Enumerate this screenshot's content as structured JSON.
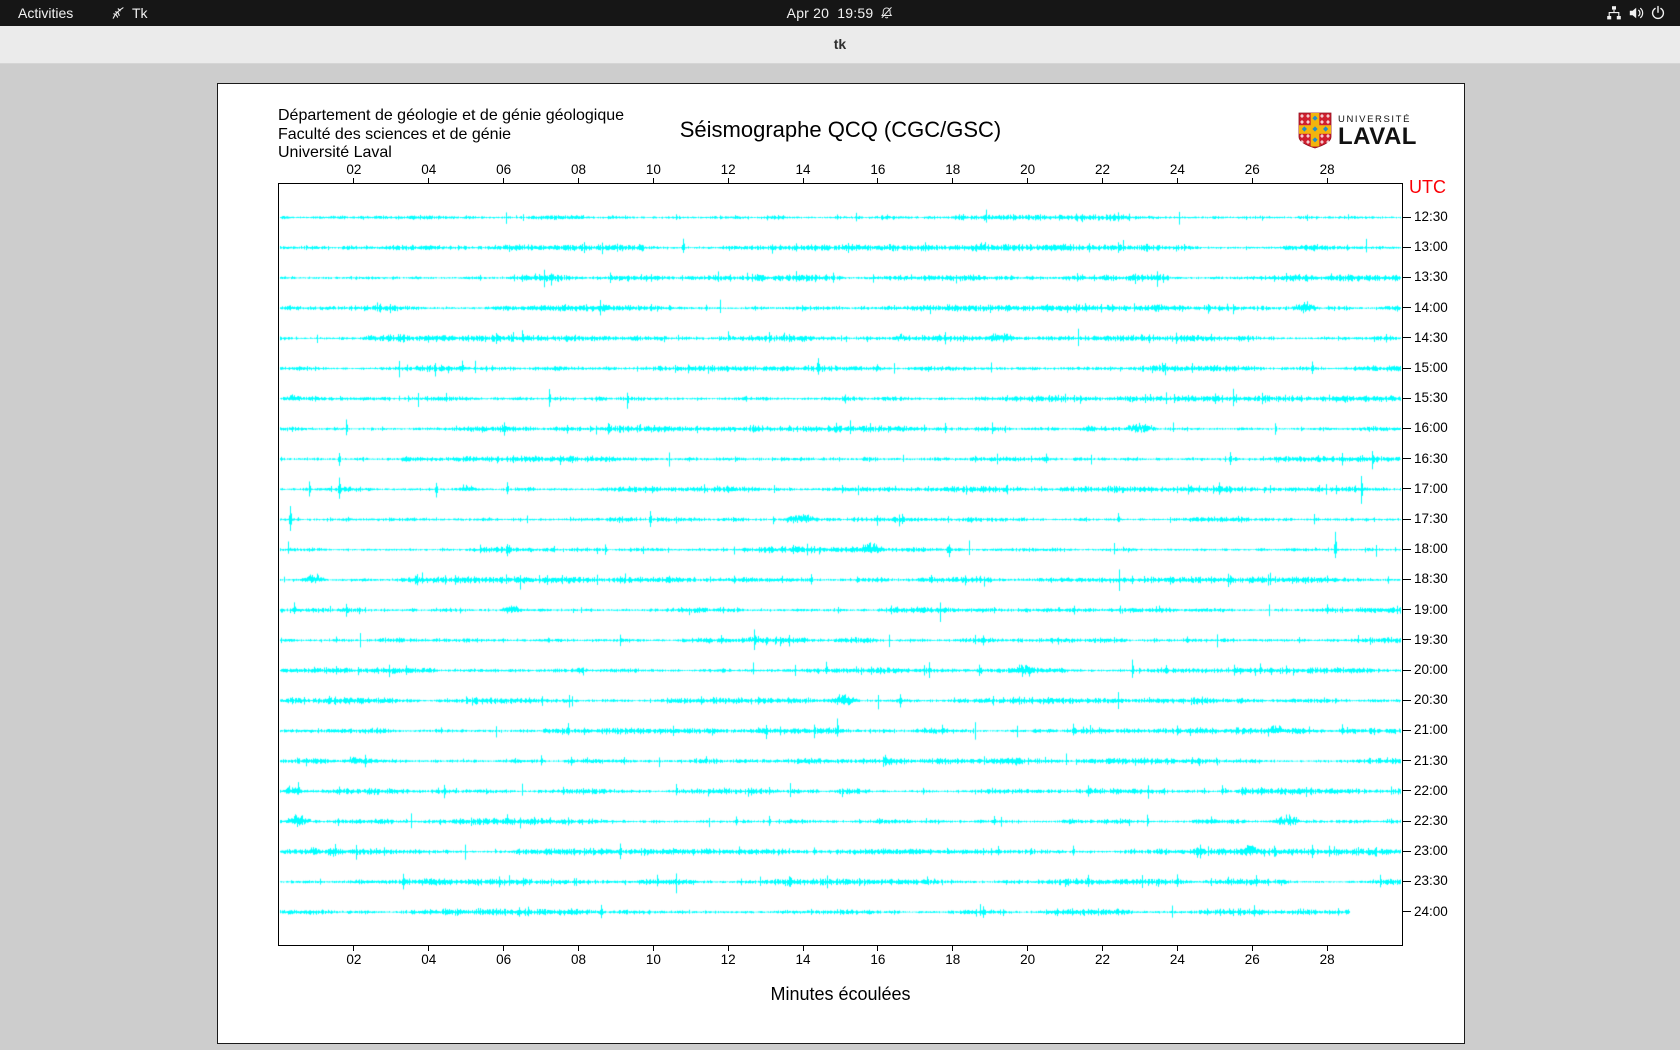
{
  "topbar": {
    "activities": "Activities",
    "app_name": "Tk",
    "clock_date": "Apr 20",
    "clock_time": "19:59"
  },
  "titlebar": {
    "title": "tk"
  },
  "window": {
    "header_lines": [
      "Département de géologie et de génie géologique",
      "Faculté des sciences et de génie",
      "Université Laval"
    ],
    "logo": {
      "small": "UNIVERSITÉ",
      "big": "LAVAL"
    }
  },
  "colors": {
    "trace": "#00ffff",
    "utc_label": "#fb0006",
    "frame": "#000000",
    "window_bg": "#ffffff",
    "desktop_bg": "#cdcdcd",
    "topbar_bg": "#161616",
    "titlebar_bg": "#ebebeb"
  },
  "chart_data": {
    "type": "line",
    "subtype": "seismogram-helicorder",
    "station": "QCQ (CGC/GSC)",
    "title": "Séismographe QCQ (CGC/GSC)",
    "xlabel": "Minutes écoulées",
    "right_axis_title": "UTC",
    "x_range_minutes": [
      0,
      30
    ],
    "x_ticks": [
      "02",
      "04",
      "06",
      "08",
      "10",
      "12",
      "14",
      "16",
      "18",
      "20",
      "22",
      "24",
      "26",
      "28"
    ],
    "trace_interval_minutes": 30,
    "trace_color": "#00ffff",
    "grid": false,
    "traces": [
      {
        "utc": "12:30",
        "seed": 101,
        "spikes": [
          [
            14.9,
            5
          ]
        ],
        "bursts": []
      },
      {
        "utc": "13:00",
        "seed": 102,
        "spikes": [
          [
            10.8,
            10
          ],
          [
            23.2,
            4
          ]
        ],
        "bursts": []
      },
      {
        "utc": "13:30",
        "seed": 103,
        "spikes": [
          [
            14.8,
            9
          ],
          [
            28.1,
            5
          ]
        ],
        "bursts": []
      },
      {
        "utc": "14:00",
        "seed": 104,
        "spikes": [
          [
            2.7,
            8
          ],
          [
            11.4,
            4
          ]
        ],
        "bursts": [
          [
            27.4,
            0.8,
            2.5
          ]
        ]
      },
      {
        "utc": "14:30",
        "seed": 105,
        "spikes": [
          [
            6.5,
            8
          ],
          [
            12.0,
            7
          ]
        ],
        "bursts": [
          [
            19.3,
            1.0,
            2.5
          ],
          [
            16.6,
            0.5,
            2.0
          ]
        ]
      },
      {
        "utc": "15:00",
        "seed": 106,
        "spikes": [
          [
            4.9,
            9
          ],
          [
            5.7,
            6
          ],
          [
            14.4,
            10
          ],
          [
            23.6,
            7
          ],
          [
            27.6,
            8
          ]
        ],
        "bursts": []
      },
      {
        "utc": "15:30",
        "seed": 107,
        "spikes": [
          [
            7.2,
            10
          ],
          [
            9.3,
            12
          ],
          [
            25.0,
            9
          ]
        ],
        "bursts": [
          [
            0.4,
            0.5,
            2.0
          ]
        ]
      },
      {
        "utc": "16:00",
        "seed": 108,
        "spikes": [
          [
            1.8,
            9
          ],
          [
            6.0,
            8
          ],
          [
            7.7,
            7
          ],
          [
            12.9,
            6
          ],
          [
            17.8,
            7
          ],
          [
            26.6,
            8
          ]
        ],
        "bursts": [
          [
            23.0,
            1.0,
            2.5
          ]
        ]
      },
      {
        "utc": "16:30",
        "seed": 109,
        "spikes": [
          [
            1.6,
            8
          ],
          [
            7.5,
            7
          ],
          [
            20.5,
            6
          ],
          [
            25.4,
            7
          ],
          [
            29.2,
            16
          ]
        ],
        "bursts": []
      },
      {
        "utc": "17:00",
        "seed": 110,
        "spikes": [
          [
            0.8,
            10
          ],
          [
            1.6,
            12
          ],
          [
            4.2,
            10
          ],
          [
            6.1,
            8
          ],
          [
            28.9,
            18
          ]
        ],
        "bursts": [
          [
            5.0,
            0.5,
            2.0
          ]
        ]
      },
      {
        "utc": "17:30",
        "seed": 111,
        "spikes": [
          [
            0.3,
            14
          ],
          [
            9.9,
            12
          ],
          [
            13.2,
            6
          ],
          [
            22.4,
            7
          ]
        ],
        "bursts": [
          [
            13.9,
            1.0,
            2.5
          ]
        ]
      },
      {
        "utc": "18:00",
        "seed": 112,
        "spikes": [
          [
            6.1,
            8
          ],
          [
            8.7,
            7
          ],
          [
            17.9,
            9
          ],
          [
            28.2,
            20
          ]
        ],
        "bursts": [
          [
            15.8,
            0.8,
            2.8
          ]
        ]
      },
      {
        "utc": "18:30",
        "seed": 113,
        "spikes": [
          [
            14.2,
            10
          ],
          [
            22.8,
            8
          ],
          [
            28.0,
            5
          ]
        ],
        "bursts": [
          [
            0.9,
            0.8,
            2.5
          ]
        ]
      },
      {
        "utc": "19:00",
        "seed": 114,
        "spikes": [
          [
            0.4,
            8
          ],
          [
            1.8,
            9
          ],
          [
            16.5,
            6
          ],
          [
            23.5,
            5
          ],
          [
            28.0,
            6
          ]
        ],
        "bursts": [
          [
            6.2,
            0.6,
            2.2
          ]
        ]
      },
      {
        "utc": "19:30",
        "seed": 115,
        "spikes": [
          [
            11.8,
            6
          ],
          [
            12.7,
            12
          ],
          [
            18.8,
            9
          ]
        ],
        "bursts": [
          [
            12.7,
            0.5,
            2.0
          ]
        ]
      },
      {
        "utc": "20:00",
        "seed": 116,
        "spikes": [
          [
            3.4,
            10
          ],
          [
            14.6,
            9
          ],
          [
            18.7,
            7
          ],
          [
            22.8,
            11
          ],
          [
            23.7,
            9
          ],
          [
            25.5,
            8
          ],
          [
            26.2,
            7
          ]
        ],
        "bursts": [
          [
            19.9,
            0.7,
            2.6
          ]
        ]
      },
      {
        "utc": "20:30",
        "seed": 117,
        "spikes": [
          [
            5.0,
            7
          ],
          [
            12.8,
            5
          ],
          [
            16.6,
            9
          ],
          [
            19.6,
            6
          ]
        ],
        "bursts": [
          [
            15.1,
            0.9,
            2.8
          ]
        ]
      },
      {
        "utc": "21:00",
        "seed": 118,
        "spikes": [
          [
            13.0,
            10
          ],
          [
            14.9,
            12
          ],
          [
            17.7,
            8
          ],
          [
            21.2,
            7
          ],
          [
            28.4,
            9
          ]
        ],
        "bursts": [
          [
            26.6,
            0.6,
            2.4
          ]
        ]
      },
      {
        "utc": "21:30",
        "seed": 119,
        "spikes": [
          [
            2.3,
            8
          ],
          [
            7.0,
            9
          ],
          [
            7.8,
            7
          ],
          [
            11.4,
            6
          ],
          [
            16.2,
            7
          ],
          [
            24.4,
            6
          ]
        ],
        "bursts": [
          [
            2.0,
            0.5,
            2.0
          ]
        ]
      },
      {
        "utc": "22:00",
        "seed": 120,
        "spikes": [
          [
            0.5,
            9
          ],
          [
            1.6,
            8
          ],
          [
            4.4,
            10
          ],
          [
            7.6,
            8
          ],
          [
            10.6,
            7
          ],
          [
            13.1,
            6
          ],
          [
            17.2,
            6
          ],
          [
            21.6,
            7
          ],
          [
            25.2,
            6
          ]
        ],
        "bursts": [
          [
            0.3,
            0.6,
            2.2
          ]
        ]
      },
      {
        "utc": "22:30",
        "seed": 121,
        "spikes": [
          [
            6.1,
            8
          ],
          [
            12.2,
            7
          ],
          [
            13.1,
            6
          ],
          [
            19.1,
            7
          ],
          [
            23.2,
            9
          ],
          [
            24.9,
            6
          ]
        ],
        "bursts": [
          [
            0.5,
            0.8,
            3.0
          ],
          [
            26.9,
            0.9,
            2.6
          ]
        ]
      },
      {
        "utc": "23:00",
        "seed": 122,
        "spikes": [
          [
            1.5,
            8
          ],
          [
            2.6,
            7
          ],
          [
            9.1,
            9
          ],
          [
            12.3,
            7
          ],
          [
            14.3,
            8
          ],
          [
            19.2,
            7
          ],
          [
            21.2,
            6
          ],
          [
            24.6,
            8
          ],
          [
            27.6,
            10
          ]
        ],
        "bursts": [
          [
            25.9,
            0.8,
            2.8
          ],
          [
            0.9,
            0.5,
            2.2
          ]
        ]
      },
      {
        "utc": "23:30",
        "seed": 123,
        "spikes": [
          [
            3.3,
            10
          ],
          [
            10.1,
            7
          ],
          [
            17.3,
            6
          ],
          [
            21.6,
            8
          ],
          [
            24.0,
            9
          ],
          [
            26.1,
            7
          ]
        ],
        "bursts": []
      },
      {
        "utc": "24:00",
        "seed": 124,
        "spikes": [
          [
            6.4,
            9
          ],
          [
            8.6,
            8
          ],
          [
            14.2,
            6
          ],
          [
            18.8,
            7
          ],
          [
            28.3,
            5
          ]
        ],
        "bursts": [],
        "end_minute": 28.6
      }
    ]
  }
}
